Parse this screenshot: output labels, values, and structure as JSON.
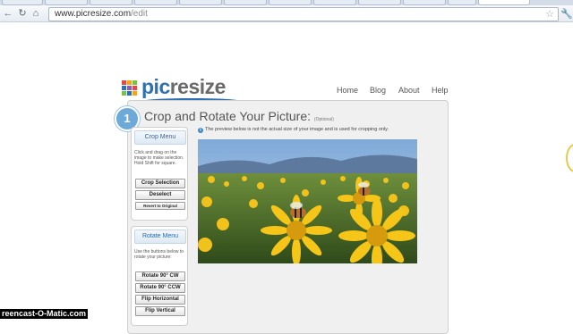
{
  "browser": {
    "url_host": "www.picresize.com",
    "url_path": "/edit"
  },
  "brand": {
    "logo_pic": "pic",
    "logo_resize": "resize"
  },
  "nav": {
    "home": "Home",
    "blog": "Blog",
    "about": "About",
    "help": "Help"
  },
  "step": {
    "number": "1",
    "title": "Crop and Rotate Your Picture:",
    "optional": "(Optional)"
  },
  "preview_note": "The preview below is not the actual size of your image and is used for cropping only.",
  "crop_menu": {
    "heading": "Crop Menu",
    "desc": "Click and drag on the image to make selection. Hold Shift for square.",
    "crop_selection": "Crop Selection",
    "deselect": "Deselect",
    "revert": "Revert to Original"
  },
  "rotate_menu": {
    "heading": "Rotate Menu",
    "desc": "Use the buttons below to rotate your picture:",
    "rotate_cw": "Rotate 90° CW",
    "rotate_ccw": "Rotate 90° CCW",
    "flip_h": "Flip Horizontal",
    "flip_v": "Flip Vertical"
  },
  "watermark": "reencast-O-Matic.com",
  "colors": {
    "brand_blue": "#2f70b4",
    "badge_blue": "#6eaad9"
  }
}
